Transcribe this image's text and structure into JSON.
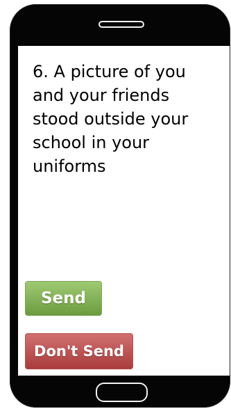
{
  "message": {
    "text": "6. A picture of you and your friends stood outside your school in your uniforms"
  },
  "buttons": {
    "send_label": "Send",
    "dont_send_label": "Don't Send"
  },
  "colors": {
    "send": "#7fae4f",
    "dont_send": "#bf4f4f",
    "phone_body": "#050505"
  }
}
